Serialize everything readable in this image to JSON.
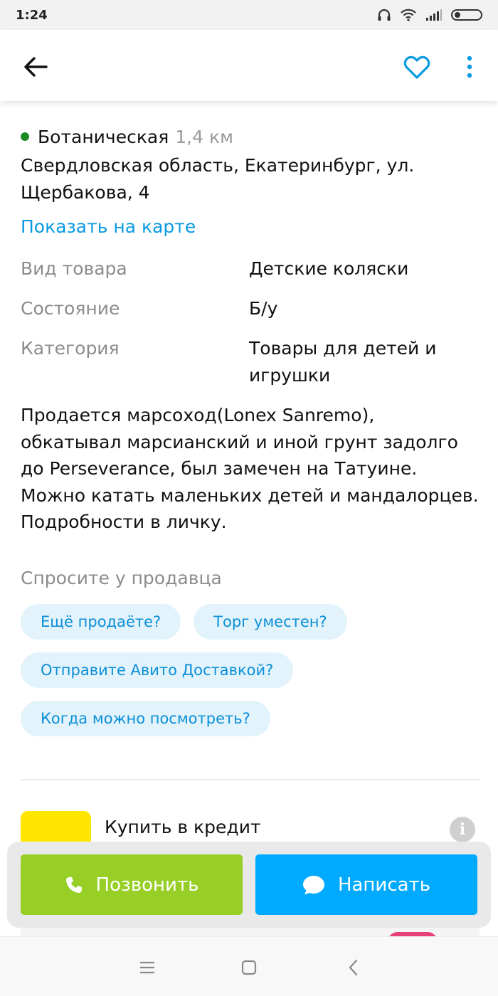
{
  "status_bar": {
    "time": "1:24"
  },
  "toolbar": {
    "back_icon": "arrow-left-icon",
    "favorite_icon": "heart-outline-icon",
    "more_icon": "more-vertical-icon",
    "accent_color": "#0a9ae2"
  },
  "location": {
    "metro_station": "Ботаническая",
    "metro_distance": "1,4 км",
    "metro_line_color": "#1a8a24",
    "address": "Свердловская область, Екатеринбург, ул. Щербакова, 4",
    "show_on_map": "Показать на карте"
  },
  "params": [
    {
      "key": "Вид товара",
      "value": "Детские коляски"
    },
    {
      "key": "Состояние",
      "value": "Б/у"
    },
    {
      "key": "Категория",
      "value": "Товары для детей и игрушки"
    }
  ],
  "description": "Продается марсоход(Lonex Sanremo), обкатывал марсианский и иной грунт задолго до Perseverance, был замечен на Татуине. Можно катать маленьких детей и мандалорцев. Подробности в личку.",
  "ask_seller": {
    "title": "Спросите у продавца",
    "chips": [
      "Ещё продаёте?",
      "Торг уместен?",
      "Отправите Авито Доставкой?",
      "Когда можно посмотреть?"
    ]
  },
  "credit": {
    "title": "Купить в кредит",
    "info_icon": "info-icon"
  },
  "actions": {
    "call_label": "Позвонить",
    "write_label": "Написать",
    "call_color": "#97cf26",
    "write_color": "#00aaff"
  },
  "nav_bar": {
    "menu_icon": "menu-icon",
    "home_icon": "square-home-icon",
    "back_icon": "chevron-back-icon"
  }
}
